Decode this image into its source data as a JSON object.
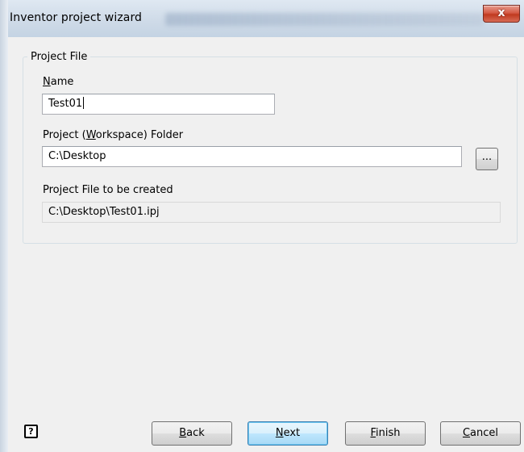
{
  "window": {
    "title": "Inventor project wizard",
    "close_symbol": "x"
  },
  "project_file": {
    "group_title": "Project File",
    "name_label_first": "N",
    "name_label_rest": "ame",
    "name_value": "Test01",
    "folder_label_before": "Project (",
    "folder_label_mnemonic": "W",
    "folder_label_after": "orkspace) Folder",
    "folder_value": "C:\\Desktop",
    "browse_label": "...",
    "created_label": "Project File to be created",
    "created_value": "C:\\Desktop\\Test01.ipj"
  },
  "footer": {
    "help_symbol": "?",
    "back_mnemonic": "B",
    "back_rest": "ack",
    "next_mnemonic": "N",
    "next_rest": "ext",
    "finish_mnemonic": "F",
    "finish_rest": "inish",
    "cancel_mnemonic": "C",
    "cancel_rest": "ancel"
  },
  "icons": {
    "close": "close-icon",
    "help": "help-icon"
  },
  "colors": {
    "close_button": "#c0391f",
    "default_button_border": "#3c7fb1",
    "dialog_background": "#f0f0f0"
  }
}
